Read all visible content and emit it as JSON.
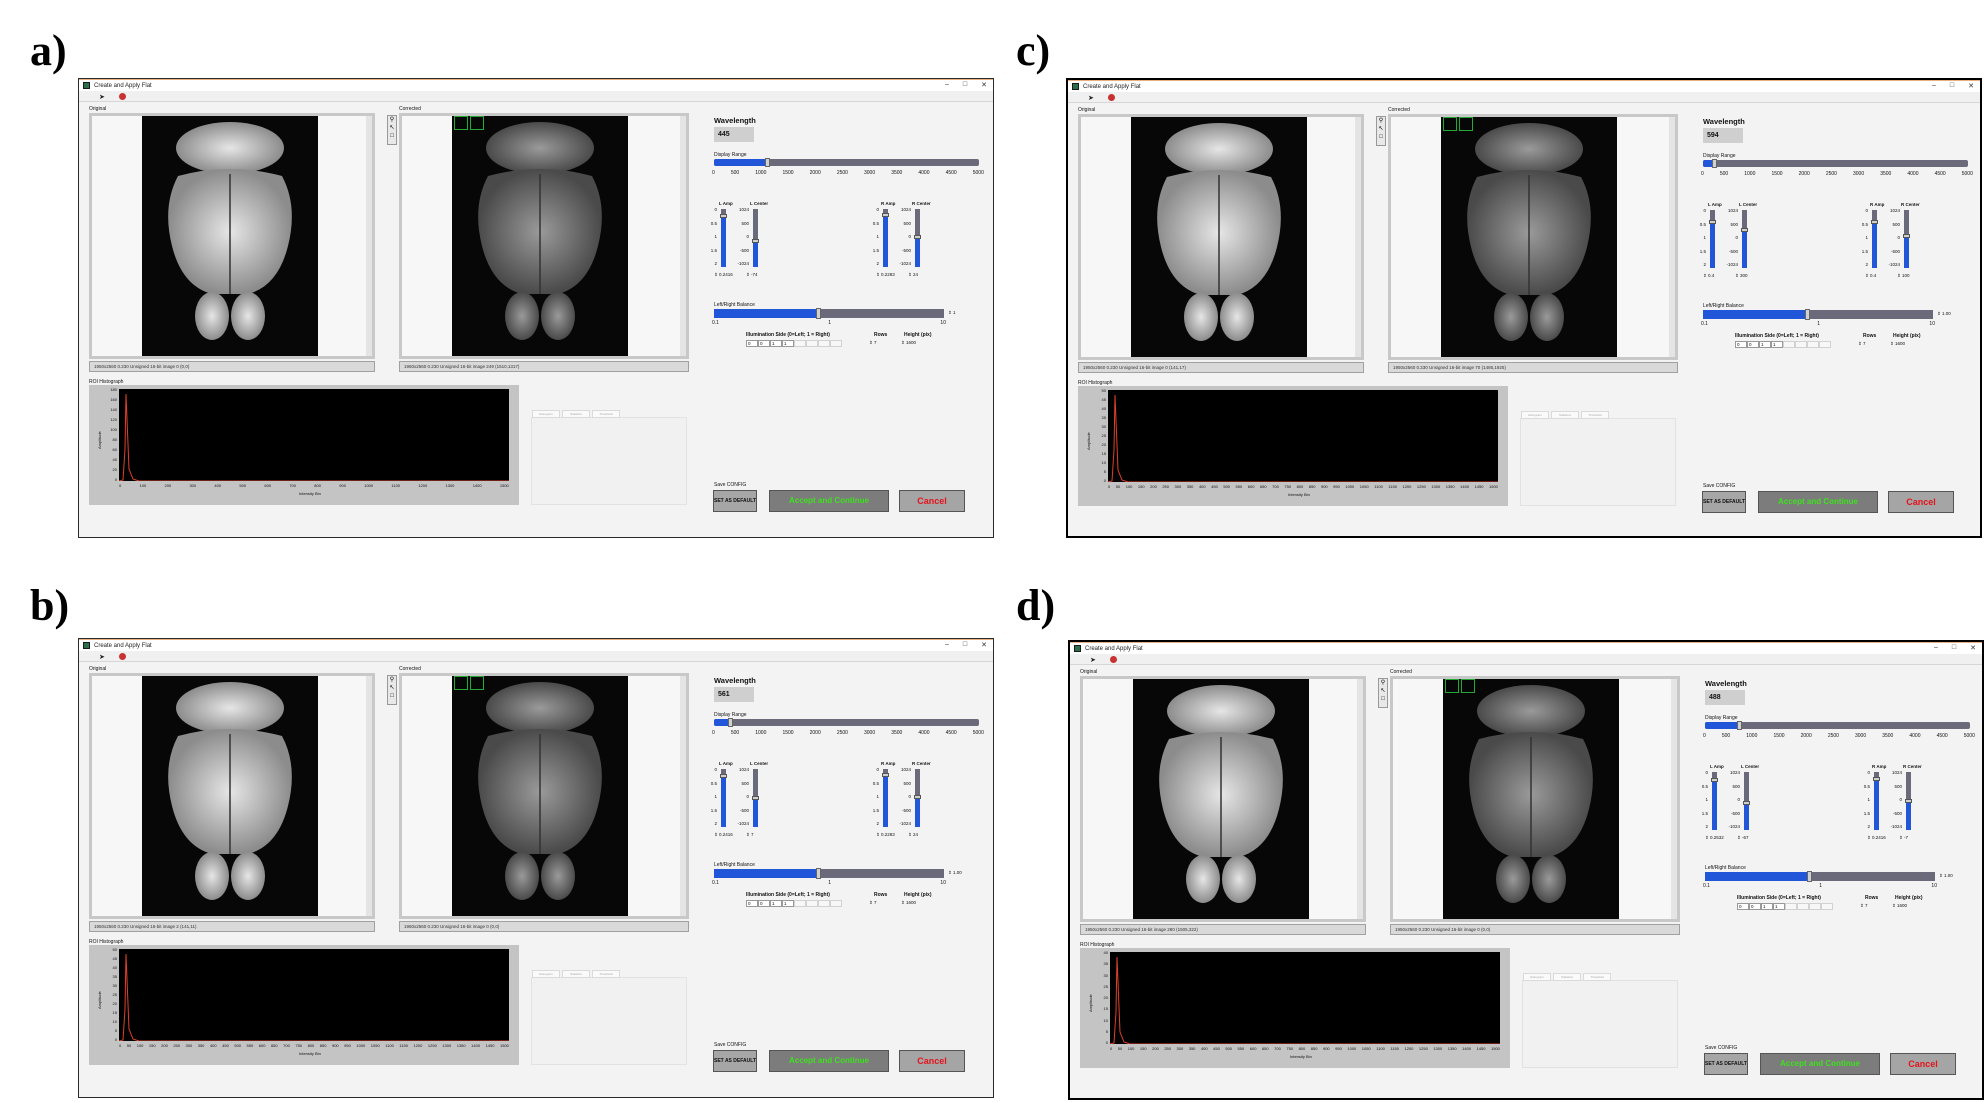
{
  "windows": [
    {
      "label": "a)",
      "title": "Create and Apply Flat",
      "original_label": "Original",
      "corrected_label": "Corrected",
      "original_status": "1950x2560 0.230 Unsigned 16-bit image 0  (0,0)",
      "corrected_status": "1950x2560 0.230 Unsigned 16-bit image 249  (1510,1317)",
      "histogram_label": "ROI Histograph",
      "histogram_xlabel": "Intensity Bin",
      "histogram_ylabel": "Amplitude",
      "histogram_yticks": [
        "180",
        "160",
        "140",
        "120",
        "100",
        "80",
        "60",
        "40",
        "20",
        "0"
      ],
      "histogram_xticks": [
        "0",
        "100",
        "200",
        "300",
        "400",
        "500",
        "600",
        "700",
        "800",
        "900",
        "1000",
        "1100",
        "1200",
        "1300",
        "1400",
        "1500"
      ],
      "hist_tabs": [
        "Histogram",
        "Statistics",
        "Threshold"
      ],
      "wavelength_title": "Wavelength",
      "wavelength_value": "445",
      "display_range_label": "Display Range",
      "display_range_ticks": [
        "0",
        "500",
        "1000",
        "1500",
        "2000",
        "2500",
        "3000",
        "3500",
        "4000",
        "4500",
        "5000"
      ],
      "display_range_fraction": 0.2,
      "l_amp_label": "L Amp",
      "l_center_label": "L Center",
      "r_amp_label": "R Amp",
      "r_center_label": "R Center",
      "amp_ticks": [
        "0",
        "0.5",
        "1",
        "1.5",
        "2"
      ],
      "center_ticks": [
        "1024",
        "500",
        "0",
        "-500",
        "-1024"
      ],
      "l_amp_value": "0.2416",
      "l_center_value": "-74",
      "r_amp_value": "0.2283",
      "r_center_value": "24",
      "l_amp_fraction": 0.88,
      "l_center_fraction": 0.44,
      "r_amp_fraction": 0.89,
      "r_center_fraction": 0.51,
      "balance_label": "Left/Right Balance",
      "balance_ticks": [
        "0.1",
        "1",
        "10"
      ],
      "balance_value": "1",
      "balance_fraction": 0.45,
      "illumination_label": "Illumination Side (0=Left; 1 = Right)",
      "illumination_values": [
        "0",
        "0",
        "1",
        "1"
      ],
      "rows_label": "Rows",
      "rows_value": "7",
      "height_label": "Height (pix)",
      "height_value": "1600",
      "save_config_label": "Save CONFIG",
      "set_default_label": "SET AS DEFAULT",
      "accept_label": "Accept and Continue",
      "cancel_label": "Cancel"
    },
    {
      "label": "b)",
      "title": "Create and Apply Flat",
      "original_label": "Original",
      "corrected_label": "Corrected",
      "original_status": "1950x2560 0.230 Unsigned 16-bit image 2  (141,11)",
      "corrected_status": "1950x2560 0.230 Unsigned 16-bit image 0  (0,0)",
      "histogram_label": "ROI Histograph",
      "histogram_xlabel": "Intensity Bin",
      "histogram_ylabel": "Amplitude",
      "histogram_yticks": [
        "50",
        "45",
        "40",
        "35",
        "30",
        "25",
        "20",
        "15",
        "10",
        "5",
        "0"
      ],
      "histogram_xticks": [
        "0",
        "50",
        "100",
        "150",
        "200",
        "250",
        "300",
        "350",
        "400",
        "450",
        "500",
        "550",
        "600",
        "650",
        "700",
        "750",
        "800",
        "850",
        "900",
        "950",
        "1000",
        "1050",
        "1100",
        "1150",
        "1200",
        "1250",
        "1300",
        "1350",
        "1400",
        "1450",
        "1500"
      ],
      "hist_tabs": [
        "Histogram",
        "Statistics",
        "Threshold"
      ],
      "wavelength_title": "Wavelength",
      "wavelength_value": "561",
      "display_range_label": "Display Range",
      "display_range_ticks": [
        "0",
        "500",
        "1000",
        "1500",
        "2000",
        "2500",
        "3000",
        "3500",
        "4000",
        "4500",
        "5000"
      ],
      "display_range_fraction": 0.06,
      "l_amp_label": "L Amp",
      "l_center_label": "L Center",
      "r_amp_label": "R Amp",
      "r_center_label": "R Center",
      "amp_ticks": [
        "0",
        "0.5",
        "1",
        "1.5",
        "2"
      ],
      "center_ticks": [
        "1024",
        "500",
        "0",
        "-500",
        "-1024"
      ],
      "l_amp_value": "0.2416",
      "l_center_value": "7",
      "r_amp_value": "0.2283",
      "r_center_value": "24",
      "l_amp_fraction": 0.88,
      "l_center_fraction": 0.5,
      "r_amp_fraction": 0.89,
      "r_center_fraction": 0.51,
      "balance_label": "Left/Right Balance",
      "balance_ticks": [
        "0.1",
        "1",
        "10"
      ],
      "balance_value": "1.00",
      "balance_fraction": 0.45,
      "illumination_label": "Illumination Side (0=Left; 1 = Right)",
      "illumination_values": [
        "0",
        "0",
        "1",
        "1"
      ],
      "rows_label": "Rows",
      "rows_value": "7",
      "height_label": "Height (pix)",
      "height_value": "1600",
      "save_config_label": "Save CONFIG",
      "set_default_label": "SET AS DEFAULT",
      "accept_label": "Accept and Continue",
      "cancel_label": "Cancel"
    },
    {
      "label": "c)",
      "title": "Create and Apply Flat",
      "original_label": "Original",
      "corrected_label": "Corrected",
      "original_status": "1950x2560 0.230 Unsigned 16-bit image 0  (141,17)",
      "corrected_status": "1950x2560 0.230 Unsigned 16-bit image 70  (1485,1925)",
      "histogram_label": "ROI Histograph",
      "histogram_xlabel": "Intensity Bin",
      "histogram_ylabel": "Amplitude",
      "histogram_yticks": [
        "50",
        "45",
        "40",
        "35",
        "30",
        "25",
        "20",
        "15",
        "10",
        "5",
        "0"
      ],
      "histogram_xticks": [
        "0",
        "50",
        "100",
        "150",
        "200",
        "250",
        "300",
        "350",
        "400",
        "450",
        "500",
        "550",
        "600",
        "650",
        "700",
        "750",
        "800",
        "850",
        "900",
        "950",
        "1000",
        "1050",
        "1100",
        "1150",
        "1200",
        "1250",
        "1300",
        "1350",
        "1400",
        "1450",
        "1500"
      ],
      "hist_tabs": [
        "Histogram",
        "Statistics",
        "Threshold"
      ],
      "wavelength_title": "Wavelength",
      "wavelength_value": "594",
      "display_range_label": "Display Range",
      "display_range_ticks": [
        "0",
        "500",
        "1000",
        "1500",
        "2000",
        "2500",
        "3000",
        "3500",
        "4000",
        "4500",
        "5000"
      ],
      "display_range_fraction": 0.04,
      "l_amp_label": "L Amp",
      "l_center_label": "L Center",
      "r_amp_label": "R Amp",
      "r_center_label": "R Center",
      "amp_ticks": [
        "0",
        "0.5",
        "1",
        "1.5",
        "2"
      ],
      "center_ticks": [
        "1024",
        "500",
        "0",
        "-500",
        "-1024"
      ],
      "l_amp_value": "0.4",
      "l_center_value": "300",
      "r_amp_value": "0.4",
      "r_center_value": "100",
      "l_amp_fraction": 0.8,
      "l_center_fraction": 0.65,
      "r_amp_fraction": 0.8,
      "r_center_fraction": 0.55,
      "balance_label": "Left/Right Balance",
      "balance_ticks": [
        "0.1",
        "1",
        "10"
      ],
      "balance_value": "1.00",
      "balance_fraction": 0.45,
      "illumination_label": "Illumination Side (0=Left; 1 = Right)",
      "illumination_values": [
        "0",
        "0",
        "1",
        "1"
      ],
      "rows_label": "Rows",
      "rows_value": "7",
      "height_label": "Height (pix)",
      "height_value": "1600",
      "save_config_label": "Save CONFIG",
      "set_default_label": "SET AS DEFAULT",
      "accept_label": "Accept and Continue",
      "cancel_label": "Cancel"
    },
    {
      "label": "d)",
      "title": "Create and Apply Flat",
      "original_label": "Original",
      "corrected_label": "Corrected",
      "original_status": "1950x2560 0.230 Unsigned 16-bit image 280  (1505,322)",
      "corrected_status": "1950x2560 0.230 Unsigned 16-bit image 0  (0,0)",
      "histogram_label": "ROI Histograph",
      "histogram_xlabel": "Intensity Bin",
      "histogram_ylabel": "Amplitude",
      "histogram_yticks": [
        "40",
        "35",
        "30",
        "25",
        "20",
        "15",
        "10",
        "5",
        "0"
      ],
      "histogram_xticks": [
        "0",
        "50",
        "100",
        "150",
        "200",
        "250",
        "300",
        "350",
        "400",
        "450",
        "500",
        "550",
        "600",
        "650",
        "700",
        "750",
        "800",
        "850",
        "900",
        "950",
        "1000",
        "1050",
        "1100",
        "1150",
        "1200",
        "1250",
        "1300",
        "1350",
        "1400",
        "1450",
        "1500"
      ],
      "hist_tabs": [
        "Histogram",
        "Statistics",
        "Threshold"
      ],
      "wavelength_title": "Wavelength",
      "wavelength_value": "488",
      "display_range_label": "Display Range",
      "display_range_ticks": [
        "0",
        "500",
        "1000",
        "1500",
        "2000",
        "2500",
        "3000",
        "3500",
        "4000",
        "4500",
        "5000"
      ],
      "display_range_fraction": 0.13,
      "l_amp_label": "L Amp",
      "l_center_label": "L Center",
      "r_amp_label": "R Amp",
      "r_center_label": "R Center",
      "amp_ticks": [
        "0",
        "0.5",
        "1",
        "1.5",
        "2"
      ],
      "center_ticks": [
        "1024",
        "500",
        "0",
        "-500",
        "-1024"
      ],
      "l_amp_value": "0.2532",
      "l_center_value": "-67",
      "r_amp_value": "0.2416",
      "r_center_value": "-7",
      "l_amp_fraction": 0.87,
      "l_center_fraction": 0.47,
      "r_amp_fraction": 0.88,
      "r_center_fraction": 0.5,
      "balance_label": "Left/Right Balance",
      "balance_ticks": [
        "0.1",
        "1",
        "10"
      ],
      "balance_value": "1.00",
      "balance_fraction": 0.45,
      "illumination_label": "Illumination Side (0=Left; 1 = Right)",
      "illumination_values": [
        "0",
        "0",
        "1",
        "1"
      ],
      "rows_label": "Rows",
      "rows_value": "7",
      "height_label": "Height (pix)",
      "height_value": "1600",
      "save_config_label": "Save CONFIG",
      "set_default_label": "SET AS DEFAULT",
      "accept_label": "Accept and Continue",
      "cancel_label": "Cancel"
    }
  ],
  "colors": {
    "slider_blue": "#2156d8",
    "slider_track": "#6a6a7a",
    "accept_text": "#3ee11f",
    "cancel_text": "#e3141b",
    "histogram_trace": "#e0402a"
  },
  "icons": {
    "run": "arrow-right-icon",
    "stop": "stop-icon",
    "minimize": "minimize-icon",
    "maximize": "maximize-icon",
    "close": "close-icon"
  }
}
